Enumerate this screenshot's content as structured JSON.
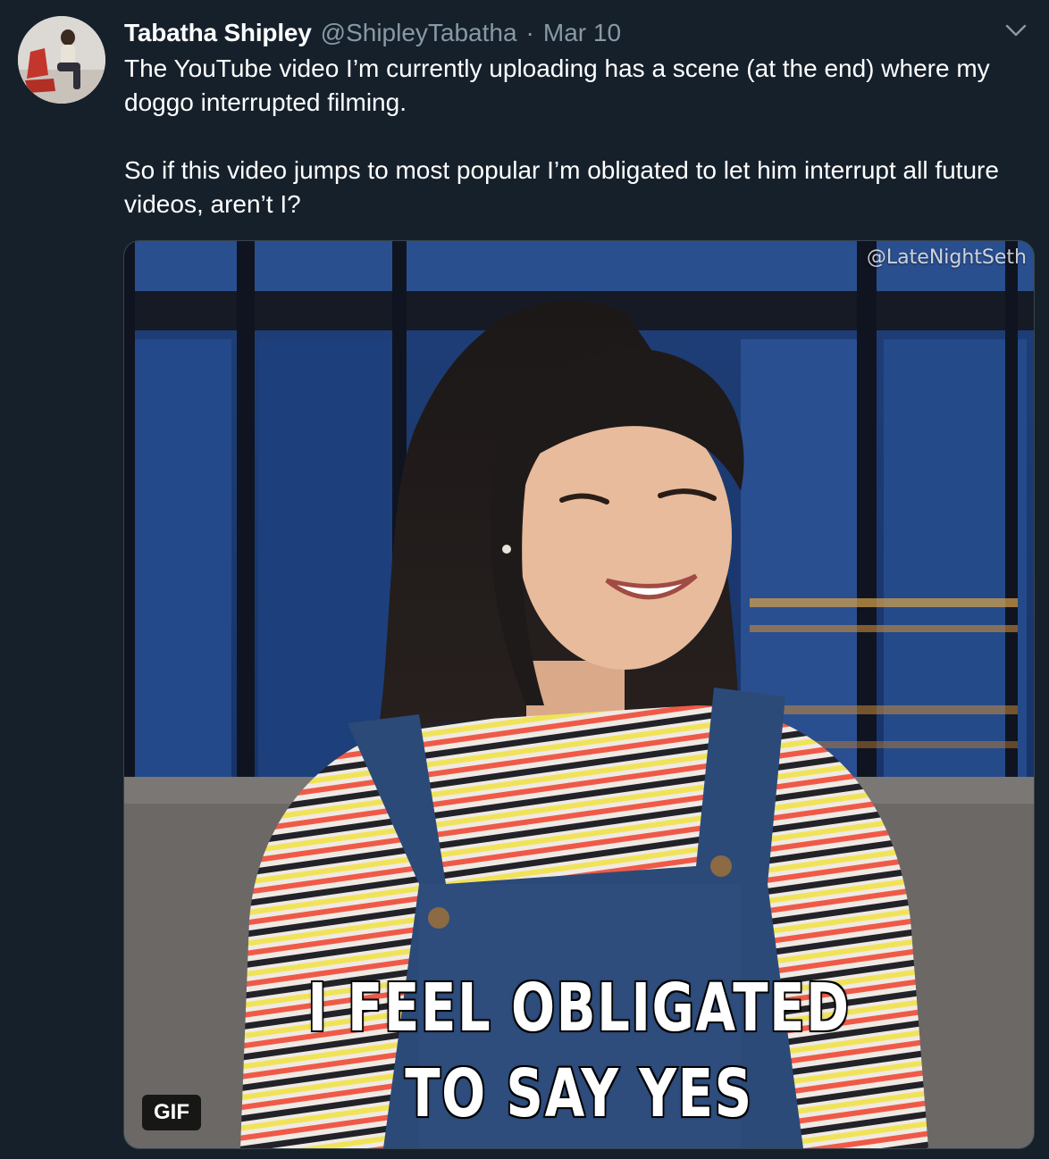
{
  "tweet": {
    "display_name": "Tabatha Shipley",
    "handle": "@ShipleyTabatha",
    "separator": "·",
    "date": "Mar 10",
    "paragraphs": [
      "The YouTube video I’m currently uploading has a scene (at the end) where my doggo interrupted filming.",
      "So if this video jumps to most popular I’m obligated to let him interrupt all future videos, aren’t I?"
    ],
    "menu_icon": "chevron-down-icon"
  },
  "media": {
    "watermark": "@LateNightSeth",
    "caption_line1": "I FEEL OBLIGATED",
    "caption_line2": "TO SAY YES",
    "badge": "GIF"
  },
  "colors": {
    "background": "#15202b",
    "secondary_text": "#8899a6",
    "border": "#38444d"
  }
}
